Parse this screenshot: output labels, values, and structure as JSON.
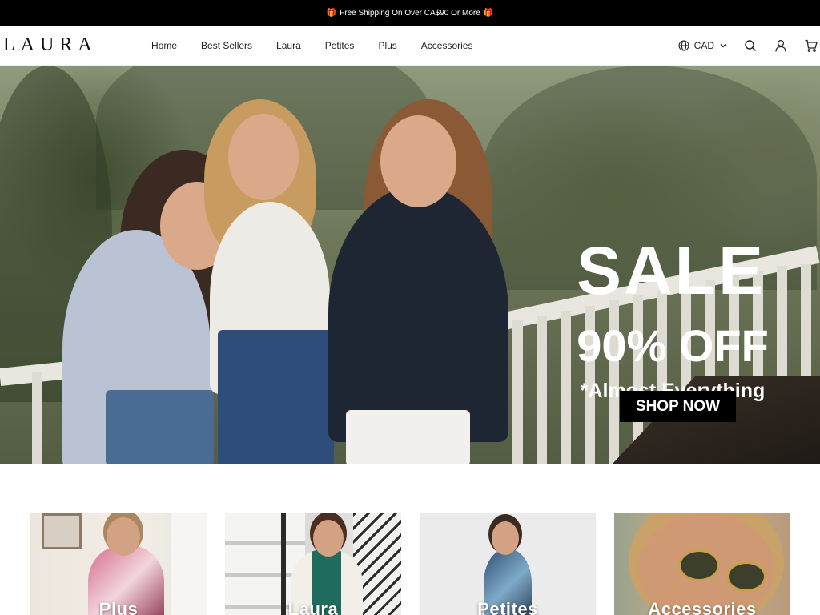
{
  "announcement": {
    "text": "Free Shipping On Over CA$90 Or More"
  },
  "header": {
    "logo": "LAURA",
    "nav": [
      "Home",
      "Best Sellers",
      "Laura",
      "Petites",
      "Plus",
      "Accessories"
    ],
    "currency": "CAD",
    "icons": [
      "globe-icon",
      "search-icon",
      "account-icon",
      "cart-icon"
    ]
  },
  "hero": {
    "headline": "SALE",
    "offer": "90% OFF",
    "subtext": "*Almost Everything",
    "cta": "SHOP NOW"
  },
  "categories": [
    {
      "label": "Plus"
    },
    {
      "label": "Laura"
    },
    {
      "label": "Petites"
    },
    {
      "label": "Accessories"
    }
  ],
  "colors": {
    "announce_bg": "#000000",
    "accent": "#000000",
    "text": "#111111"
  }
}
